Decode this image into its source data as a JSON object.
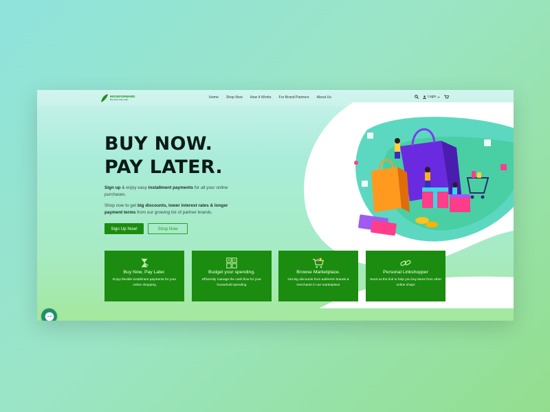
{
  "brand": {
    "name": "MOVEFORWARD",
    "tagline": "Buy Now, Pay Later"
  },
  "nav": {
    "items": [
      "Home",
      "Shop Now",
      "How It Works",
      "For Brand Partners",
      "About Us"
    ],
    "login_label": "Login"
  },
  "hero": {
    "title_line1": "BUY NOW.",
    "title_line2": "PAY LATER.",
    "p1": {
      "a": "Sign up",
      "b": " & enjoy easy ",
      "c": "installment payments",
      "d": " for all your online purchases."
    },
    "p2": {
      "a": "Shop now to get ",
      "b": "big discounts, lower interest rates & longer payment terms",
      "c": " from our growing list of partner brands."
    },
    "signup_label": "Sign Up Now!",
    "shop_label": "Shop Now"
  },
  "features": [
    {
      "title": "Buy Now, Pay Later.",
      "desc": "Enjoy flexible installment payments for your online shopping"
    },
    {
      "title": "Budget your spending.",
      "desc": "Efficiently manage the cash flow for your household spending"
    },
    {
      "title": "Browse Marketplace.",
      "desc": "Get big discounts from authentic brands & merchants in our marketplace"
    },
    {
      "title": "Personal Linkshopper",
      "desc": "Send us the link to help you buy items from other online shops"
    }
  ],
  "colors": {
    "brand_green": "#1b8c0f",
    "hero_text": "#0b1a17"
  },
  "icons": {
    "search": "search-icon",
    "user": "user-icon",
    "cart": "cart-icon",
    "messenger": "messenger-icon"
  }
}
